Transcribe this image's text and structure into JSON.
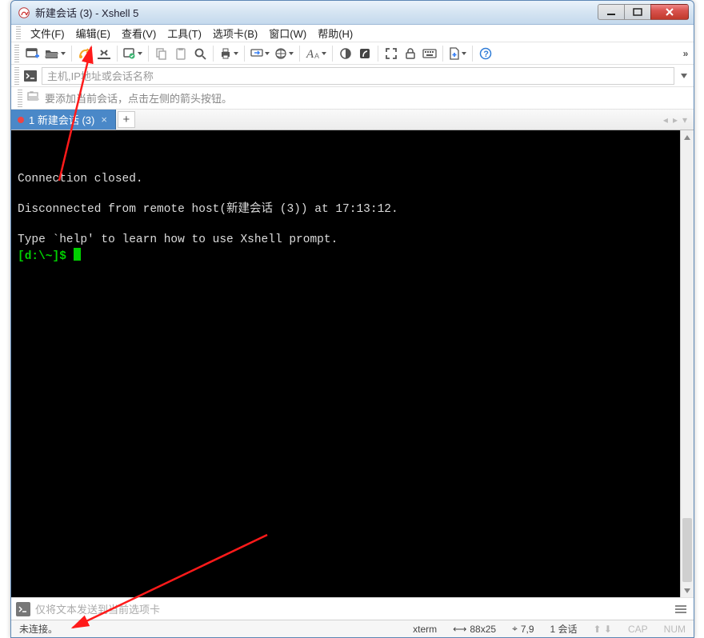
{
  "title": "新建会话 (3) - Xshell 5",
  "menu": {
    "file": "文件(F)",
    "edit": "编辑(E)",
    "view": "查看(V)",
    "tools": "工具(T)",
    "tabs": "选项卡(B)",
    "window": "窗口(W)",
    "help": "帮助(H)"
  },
  "toolbar_overflow": "»",
  "addr_placeholder": "主机,IP地址或会话名称",
  "tip_text": "要添加当前会话，点击左侧的箭头按钮。",
  "tab": {
    "label": "1 新建会话 (3)",
    "close": "×"
  },
  "newtab": "+",
  "terminal": {
    "blank": "",
    "l1": "Connection closed.",
    "l2": "Disconnected from remote host(新建会话 (3)) at 17:13:12.",
    "l3": "Type `help' to learn how to use Xshell prompt.",
    "prompt": "[d:\\~]$ "
  },
  "sendbar_placeholder": "仅将文本发送到当前选项卡",
  "status": {
    "conn": "未连接。",
    "term": "xterm",
    "size_icon": "⟷",
    "size": "88x25",
    "cursor_icon": "⌖",
    "cursor": "7,9",
    "sessions": "1 会话",
    "arrows": "⬆  ⬇",
    "cap": "CAP",
    "num": "NUM"
  }
}
